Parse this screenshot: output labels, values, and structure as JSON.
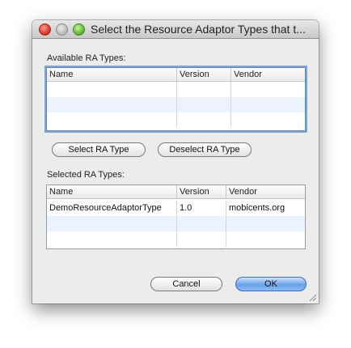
{
  "window": {
    "title": "Select the Resource Adaptor Types that t..."
  },
  "available": {
    "label": "Available RA Types:",
    "columns": [
      "Name",
      "Version",
      "Vendor"
    ],
    "rows": []
  },
  "buttons": {
    "select": "Select RA Type",
    "deselect": "Deselect RA Type",
    "cancel": "Cancel",
    "ok": "OK"
  },
  "selected": {
    "label": "Selected RA Types:",
    "columns": [
      "Name",
      "Version",
      "Vendor"
    ],
    "rows": [
      {
        "name": "DemoResourceAdaptorType",
        "version": "1.0",
        "vendor": "mobicents.org"
      }
    ]
  },
  "icons": {
    "close": "close-traffic-light-icon",
    "minimize": "minimize-traffic-light-icon",
    "zoom": "zoom-traffic-light-icon",
    "resize": "resize-grip-icon"
  },
  "colors": {
    "default_button": "#6aa2ec",
    "focus_ring": "#7fa6d9",
    "row_alt": "#edf3fe"
  }
}
